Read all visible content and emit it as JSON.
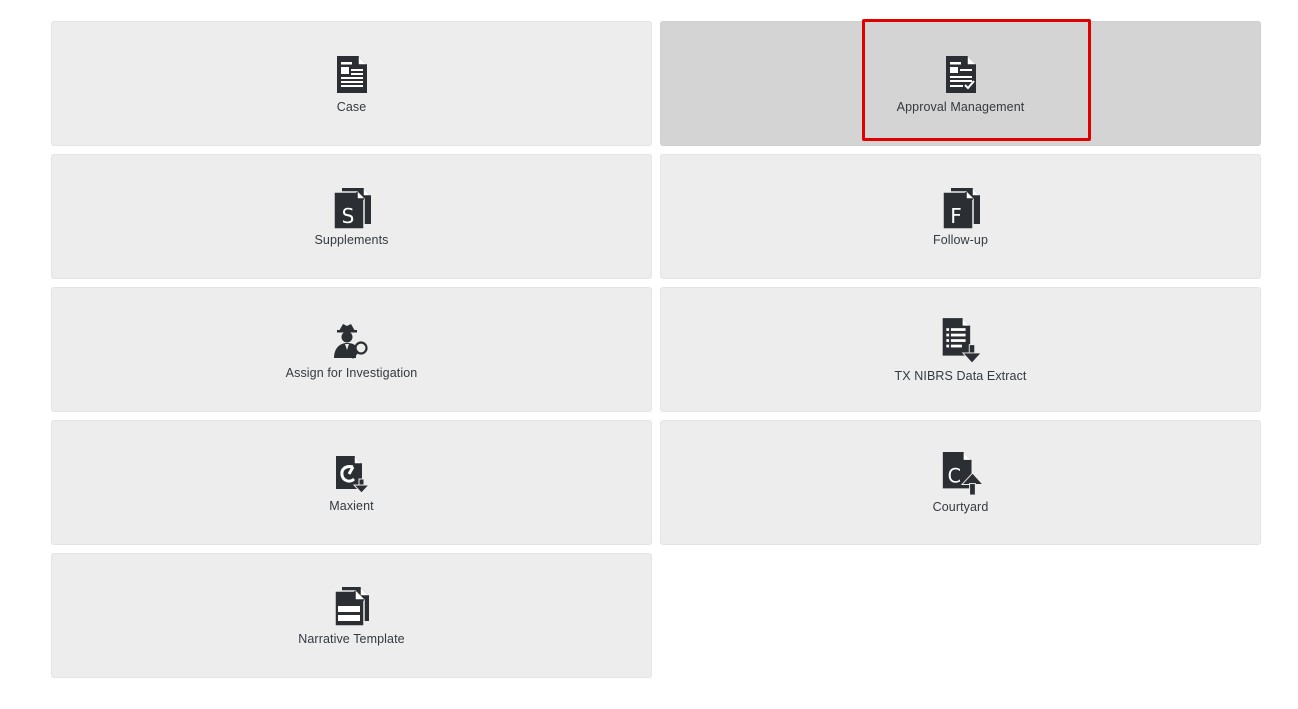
{
  "tiles": [
    {
      "label": "Case",
      "icon": "document-lines-icon"
    },
    {
      "label": "Approval Management",
      "icon": "document-check-icon",
      "selected": true
    },
    {
      "label": "Supplements",
      "icon": "file-s-icon"
    },
    {
      "label": "Follow-up",
      "icon": "file-f-icon"
    },
    {
      "label": "Assign for Investigation",
      "icon": "detective-search-icon"
    },
    {
      "label": "TX NIBRS Data Extract",
      "icon": "document-download-icon"
    },
    {
      "label": "Maxient",
      "icon": "hook-download-icon"
    },
    {
      "label": "Courtyard",
      "icon": "file-c-upload-icon"
    },
    {
      "label": "Narrative Template",
      "icon": "template-icon"
    }
  ],
  "colors": {
    "tile_bg": "#ededed",
    "tile_active_bg": "#d4d4d4",
    "icon": "#2b2f33",
    "highlight": "#e00000"
  }
}
